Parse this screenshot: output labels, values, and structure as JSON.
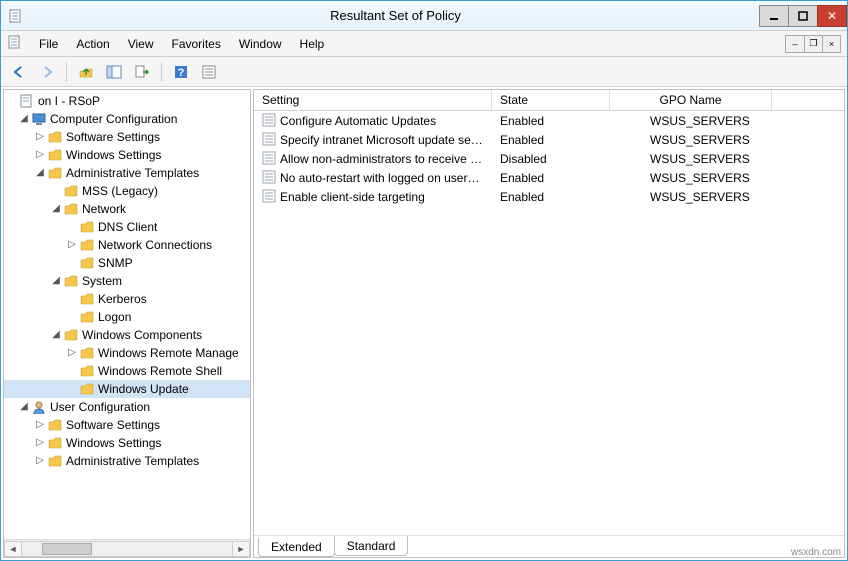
{
  "window": {
    "title": "Resultant Set of Policy"
  },
  "menu": {
    "file": "File",
    "action": "Action",
    "view": "View",
    "favorites": "Favorites",
    "window": "Window",
    "help": "Help"
  },
  "tree": {
    "root_label": "on I                  - RSoP",
    "computer_config": "Computer Configuration",
    "software_settings": "Software Settings",
    "windows_settings": "Windows Settings",
    "admin_templates": "Administrative Templates",
    "mss_legacy": "MSS (Legacy)",
    "network": "Network",
    "dns_client": "DNS Client",
    "network_connections": "Network Connections",
    "snmp": "SNMP",
    "system": "System",
    "kerberos": "Kerberos",
    "logon": "Logon",
    "windows_components": "Windows Components",
    "wrm": "Windows Remote Manage",
    "wrs": "Windows Remote Shell",
    "windows_update": "Windows Update",
    "user_config": "User Configuration",
    "u_software_settings": "Software Settings",
    "u_windows_settings": "Windows Settings",
    "u_admin_templates": "Administrative Templates"
  },
  "columns": {
    "setting": "Setting",
    "state": "State",
    "gpo": "GPO Name"
  },
  "rows": [
    {
      "setting": "Configure Automatic Updates",
      "state": "Enabled",
      "gpo": "WSUS_SERVERS"
    },
    {
      "setting": "Specify intranet Microsoft update servi...",
      "state": "Enabled",
      "gpo": "WSUS_SERVERS"
    },
    {
      "setting": "Allow non-administrators to receive up...",
      "state": "Disabled",
      "gpo": "WSUS_SERVERS"
    },
    {
      "setting": "No auto-restart with logged on users fo...",
      "state": "Enabled",
      "gpo": "WSUS_SERVERS"
    },
    {
      "setting": "Enable client-side targeting",
      "state": "Enabled",
      "gpo": "WSUS_SERVERS"
    }
  ],
  "tabs": {
    "extended": "Extended",
    "standard": "Standard"
  },
  "attribution": "wsxdn.com"
}
